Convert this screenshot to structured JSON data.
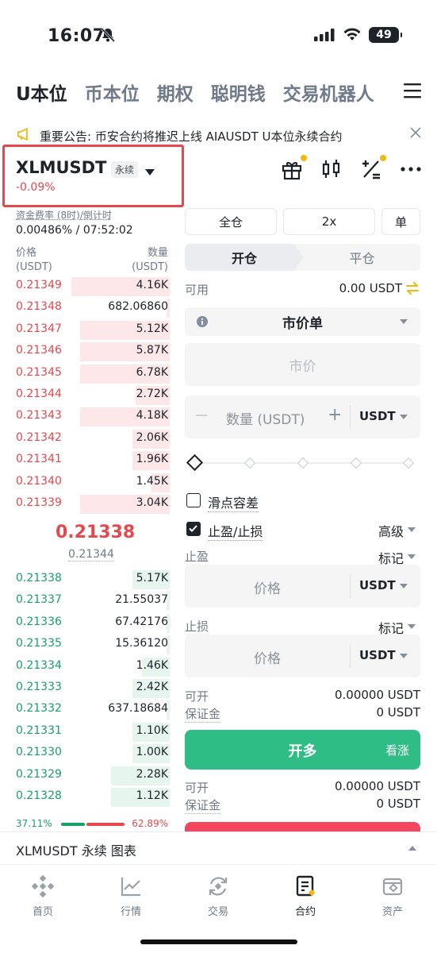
{
  "status_bar": {
    "time": "16:07",
    "battery": "49"
  },
  "top_tabs": [
    "U本位",
    "币本位",
    "期权",
    "聪明钱",
    "交易机器人"
  ],
  "announcement": "重要公告: 币安合约将推迟上线 AIAUSDT U本位永续合约",
  "pair": {
    "symbol": "XLMUSDT",
    "tag": "永续",
    "change": "-0.09%"
  },
  "funding": {
    "label": "资金费率 (8时)/倒计时",
    "value": "0.00486% / 07:52:02"
  },
  "orderbook": {
    "price_header": "价格",
    "price_unit": "(USDT)",
    "qty_header": "数量",
    "qty_unit": "(USDT)",
    "asks": [
      {
        "price": "0.21349",
        "qty": "4.16K",
        "depth": 0.64
      },
      {
        "price": "0.21348",
        "qty": "682.06860",
        "depth": 0.02
      },
      {
        "price": "0.21347",
        "qty": "5.12K",
        "depth": 0.58
      },
      {
        "price": "0.21346",
        "qty": "5.87K",
        "depth": 0.58
      },
      {
        "price": "0.21345",
        "qty": "6.78K",
        "depth": 0.58
      },
      {
        "price": "0.21344",
        "qty": "2.72K",
        "depth": 0.22
      },
      {
        "price": "0.21343",
        "qty": "4.18K",
        "depth": 0.58
      },
      {
        "price": "0.21342",
        "qty": "2.06K",
        "depth": 0.24
      },
      {
        "price": "0.21341",
        "qty": "1.96K",
        "depth": 0.24
      },
      {
        "price": "0.21340",
        "qty": "1.45K",
        "depth": 0.12
      },
      {
        "price": "0.21339",
        "qty": "3.04K",
        "depth": 0.58
      }
    ],
    "last_price": "0.21338",
    "mark_price": "0.21344",
    "bids": [
      {
        "price": "0.21338",
        "qty": "5.17K",
        "depth": 0.24
      },
      {
        "price": "0.21337",
        "qty": "21.55037",
        "depth": 0.02
      },
      {
        "price": "0.21336",
        "qty": "67.42176",
        "depth": 0.02
      },
      {
        "price": "0.21335",
        "qty": "15.36120",
        "depth": 0.02
      },
      {
        "price": "0.21334",
        "qty": "1.46K",
        "depth": 0.18
      },
      {
        "price": "0.21333",
        "qty": "2.42K",
        "depth": 0.24
      },
      {
        "price": "0.21332",
        "qty": "637.18684",
        "depth": 0.02
      },
      {
        "price": "0.21331",
        "qty": "1.10K",
        "depth": 0.24
      },
      {
        "price": "0.21330",
        "qty": "1.00K",
        "depth": 0.24
      },
      {
        "price": "0.21329",
        "qty": "2.28K",
        "depth": 0.38
      },
      {
        "price": "0.21328",
        "qty": "1.12K",
        "depth": 0.38
      }
    ],
    "buy_ratio": "37.11%",
    "sell_ratio": "62.89%",
    "buy_ratio_value": 0.3711
  },
  "form": {
    "margin_mode": "全仓",
    "leverage": "2x",
    "position_mode": "单",
    "tab_open": "开仓",
    "tab_close": "平仓",
    "available_label": "可用",
    "available_value": "0.00 USDT",
    "order_type": "市价单",
    "price_placeholder": "市价",
    "qty_placeholder": "数量 (USDT)",
    "qty_unit": "USDT",
    "slippage_label": "滑点容差",
    "tpsl_label": "止盈/止损",
    "advanced_label": "高级",
    "tp_label": "止盈",
    "tp_mark": "标记",
    "tp_placeholder": "价格",
    "tp_unit": "USDT",
    "sl_label": "止损",
    "sl_mark": "标记",
    "sl_placeholder": "价格",
    "sl_unit": "USDT",
    "long_can_open_label": "可开",
    "long_can_open_value": "0.00000 USDT",
    "long_margin_label": "保证金",
    "long_margin_value": "0 USDT",
    "long_button": "开多",
    "long_sub": "看涨",
    "short_can_open_label": "可开",
    "short_can_open_value": "0.00000 USDT",
    "short_margin_label": "保证金",
    "short_margin_value": "0 USDT"
  },
  "chart_bar": {
    "label": "XLMUSDT 永续  图表"
  },
  "nav": [
    "首页",
    "行情",
    "交易",
    "合约",
    "资产"
  ],
  "colors": {
    "red": "#e5484d",
    "green": "#19a06a",
    "buy_button": "#2ebd85",
    "brand": "#f0b90b"
  }
}
